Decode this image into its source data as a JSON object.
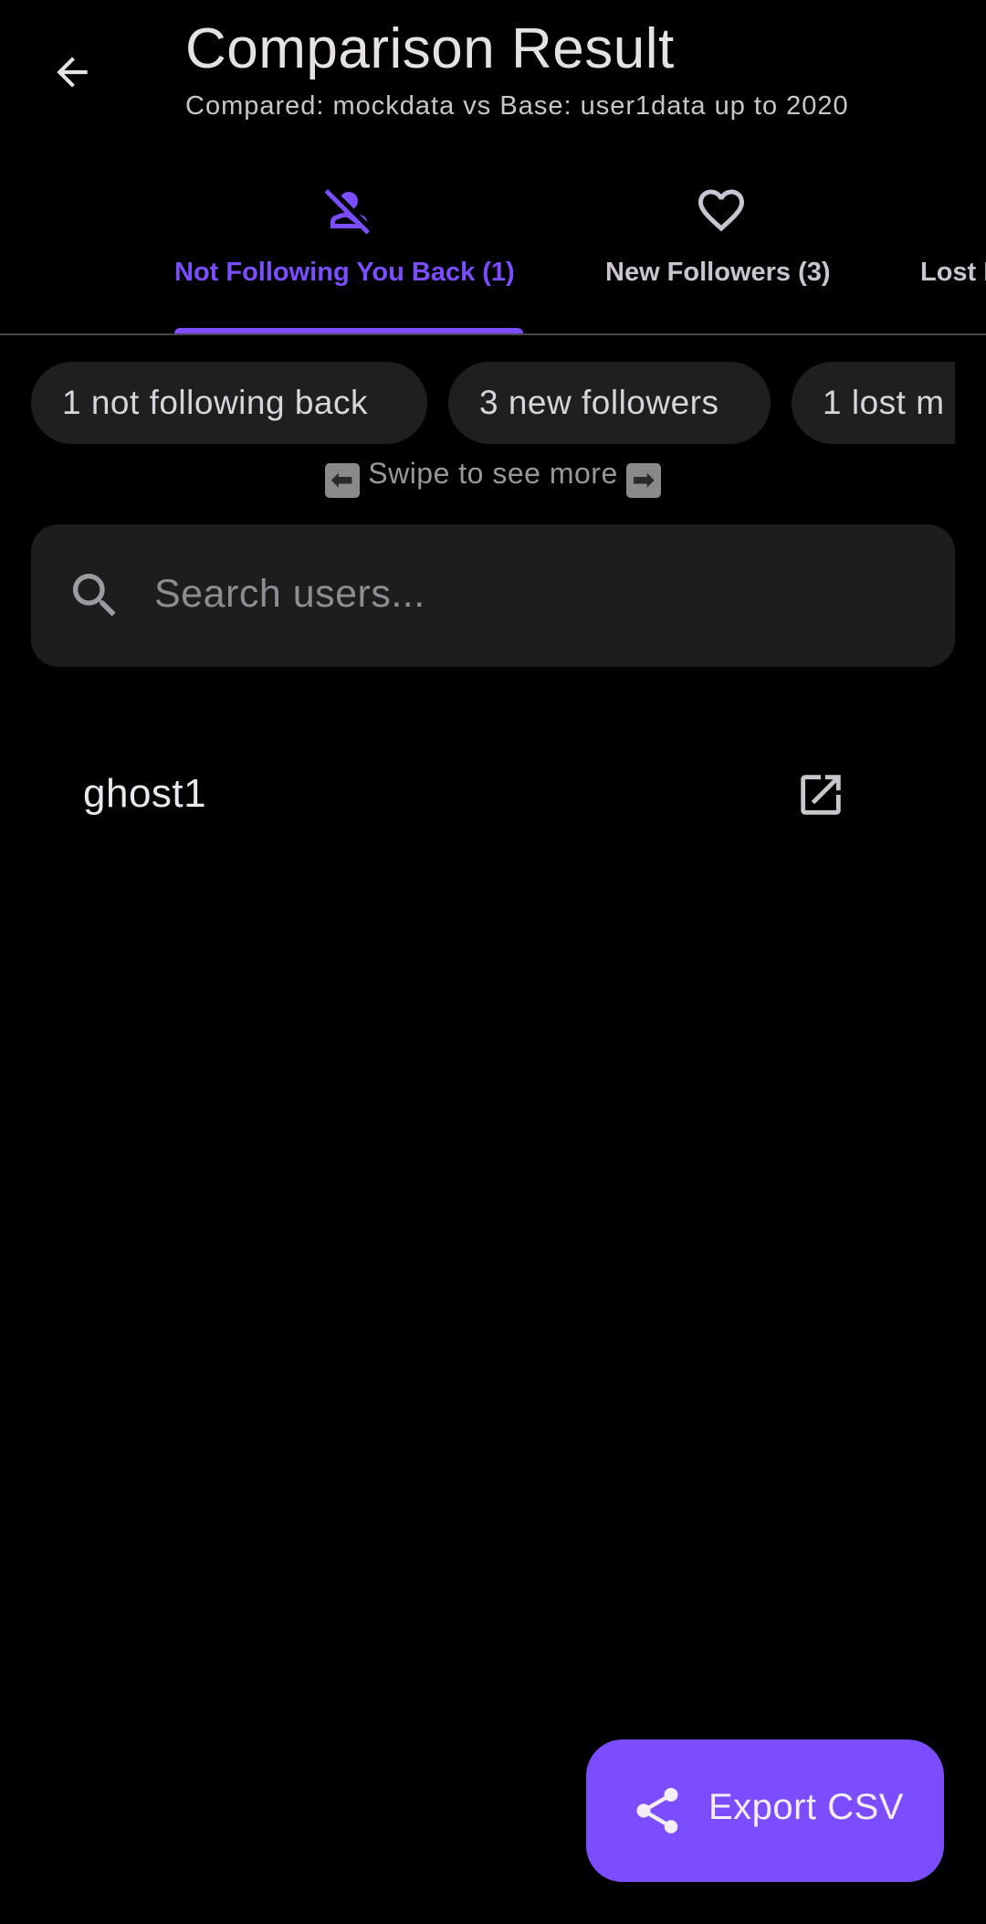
{
  "colors": {
    "background": "#000000",
    "accent": "#7c4dff",
    "surface": "#1d1d1d",
    "chip": "#1f1f1f",
    "text_primary": "#e6e1e5",
    "text_secondary": "#cac4d0"
  },
  "appbar": {
    "back_icon": "arrow-back-icon",
    "title": "Comparison Result",
    "subtitle": "Compared: mockdata vs Base: user1data up to 2020"
  },
  "tabs": [
    {
      "label": "Not Following You Back (1)",
      "icon": "person-off-icon",
      "selected": true
    },
    {
      "label": "New Followers (3)",
      "icon": "heart-outline-icon",
      "selected": false
    },
    {
      "label": "Lost M",
      "icon": "",
      "selected": false
    }
  ],
  "chips": [
    {
      "label": "1 not following back"
    },
    {
      "label": "3 new followers"
    },
    {
      "label": "1 lost m"
    }
  ],
  "swipe_hint": {
    "left_arrow": "⬅",
    "text": "Swipe to see more",
    "right_arrow": "➡"
  },
  "search": {
    "icon": "search-icon",
    "placeholder": "Search users..."
  },
  "users": [
    {
      "username": "ghost1",
      "action_icon": "open-in-new-icon"
    }
  ],
  "fab": {
    "icon": "share-icon",
    "label": "Export CSV"
  }
}
